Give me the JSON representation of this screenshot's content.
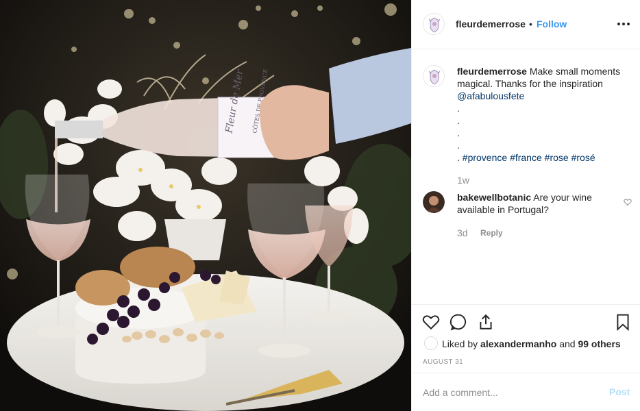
{
  "photo": {
    "alt_icon": "wine-photo",
    "bottle_label_script": "Fleur de Mer",
    "bottle_label_text": "CÔTES DE PROVENCE"
  },
  "header": {
    "username": "fleurdemerrose",
    "separator": "•",
    "follow_label": "Follow",
    "more_icon": "more-options-icon"
  },
  "caption": {
    "username": "fleurdemerrose",
    "text": "Make small moments magical. Thanks for the inspiration",
    "mention": "@afabulousfete",
    "dots": [
      ".",
      ".",
      ".",
      "."
    ],
    "last_dot": ".",
    "hashtags": [
      "#provence",
      "#france",
      "#rose",
      "#rosé"
    ],
    "time": "1w"
  },
  "comment": {
    "username": "bakewellbotanic",
    "text": "Are your wine available in Portugal?",
    "time": "3d",
    "reply_label": "Reply"
  },
  "actions": {
    "liked_by_prefix": "Liked by",
    "liked_by_user": "alexandermanho",
    "and_word": "and",
    "others": "99 others",
    "date": "AUGUST 31"
  },
  "add_comment": {
    "placeholder": "Add a comment...",
    "post_label": "Post"
  },
  "colors": {
    "accent": "#3897f0",
    "muted": "#8e8e8e",
    "post_disabled": "#b2dffc",
    "link": "#003569"
  }
}
